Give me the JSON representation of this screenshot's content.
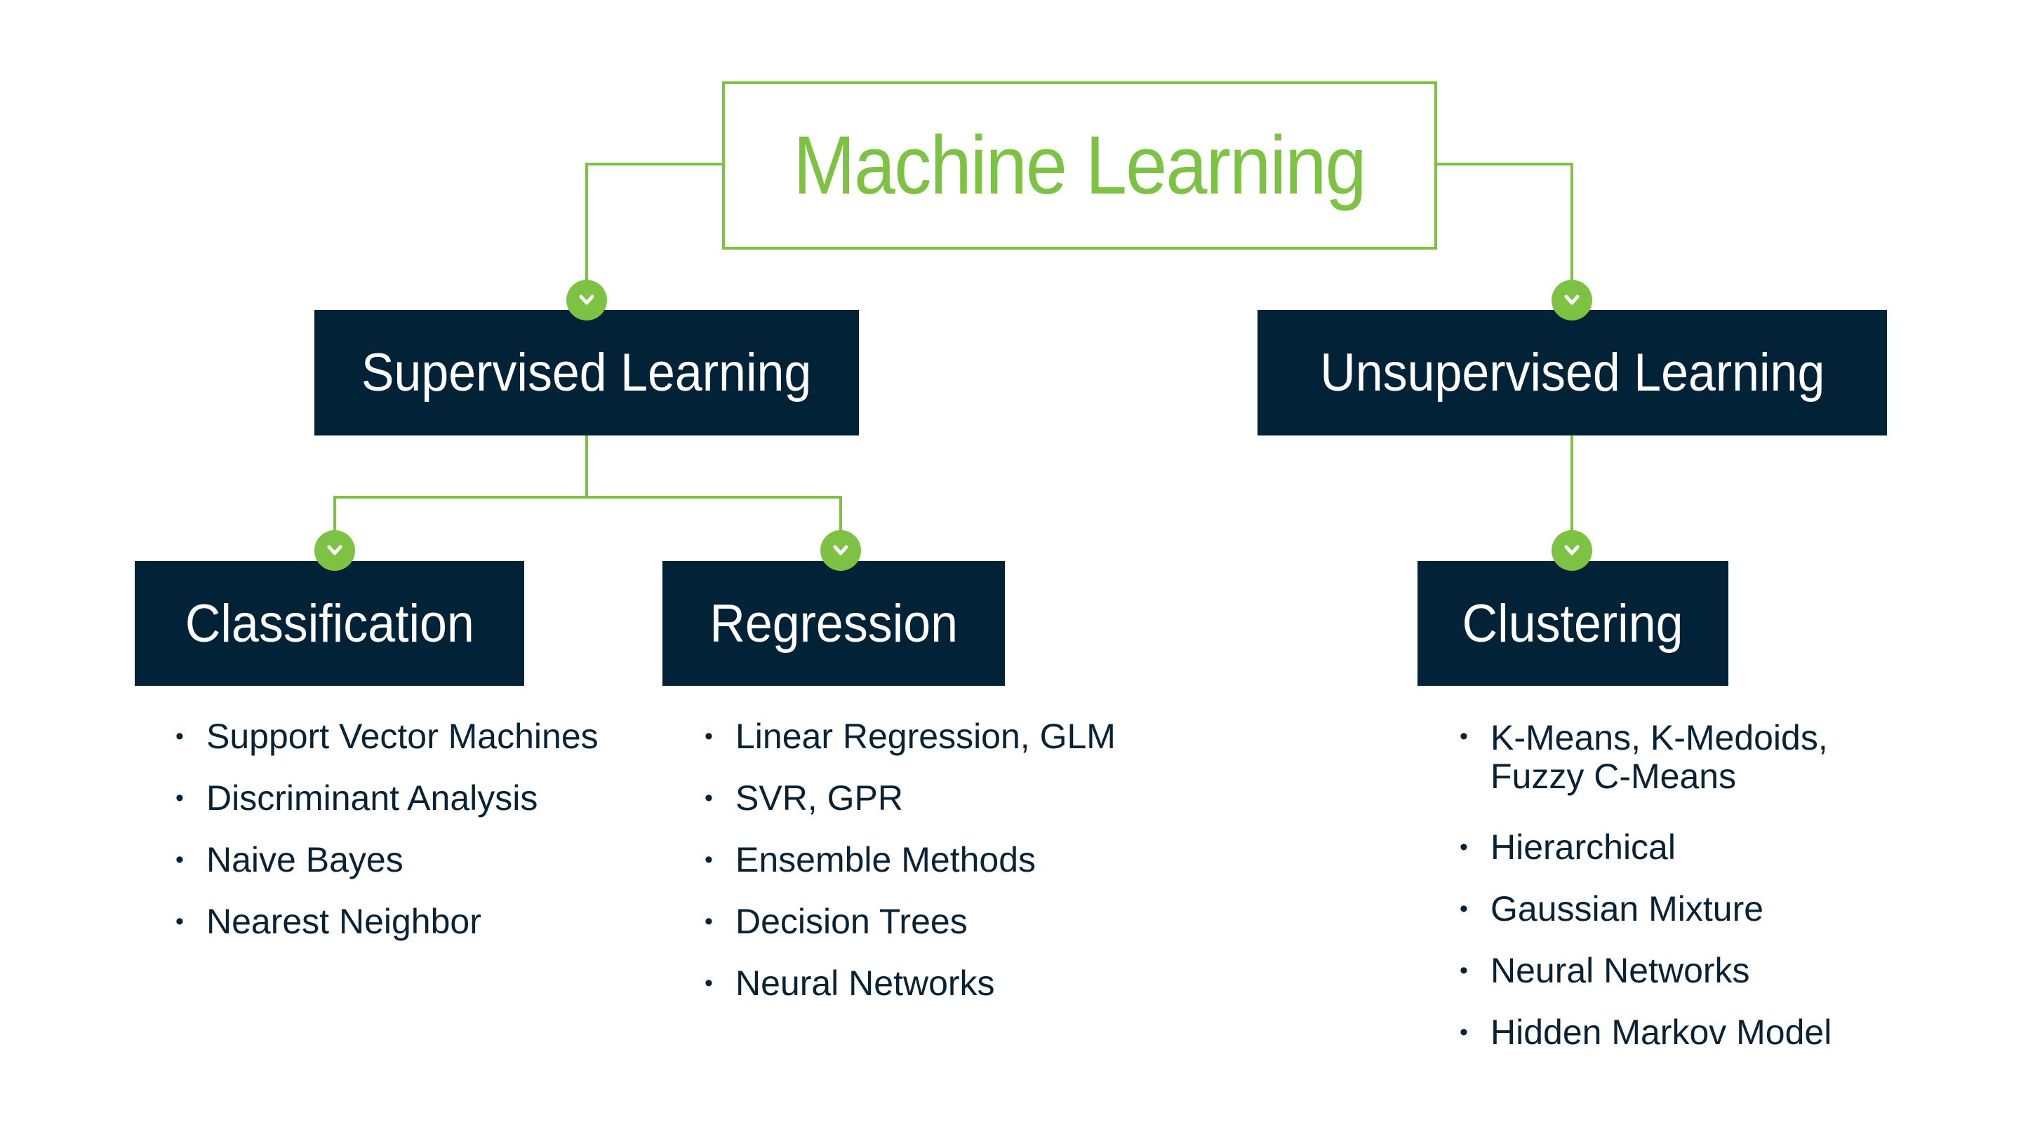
{
  "root": {
    "label": "Machine Learning"
  },
  "branches": [
    {
      "label": "Supervised Learning",
      "children": [
        {
          "label": "Classification",
          "items": [
            "Support Vector Machines",
            "Discriminant Analysis",
            "Naive Bayes",
            "Nearest Neighbor"
          ]
        },
        {
          "label": "Regression",
          "items": [
            "Linear Regression, GLM",
            "SVR, GPR",
            "Ensemble Methods",
            "Decision Trees",
            "Neural Networks"
          ]
        }
      ]
    },
    {
      "label": "Unsupervised Learning",
      "children": [
        {
          "label": "Clustering",
          "items": [
            "K-Means, K-Medoids,",
            "Fuzzy C-Means",
            "Hierarchical",
            "Gaussian Mixture",
            "Neural Networks",
            "Hidden Markov Model"
          ]
        }
      ]
    }
  ],
  "bullet": "•",
  "colors": {
    "accent": "#7dc242",
    "node_bg": "#022238",
    "text": "#0a2236"
  }
}
